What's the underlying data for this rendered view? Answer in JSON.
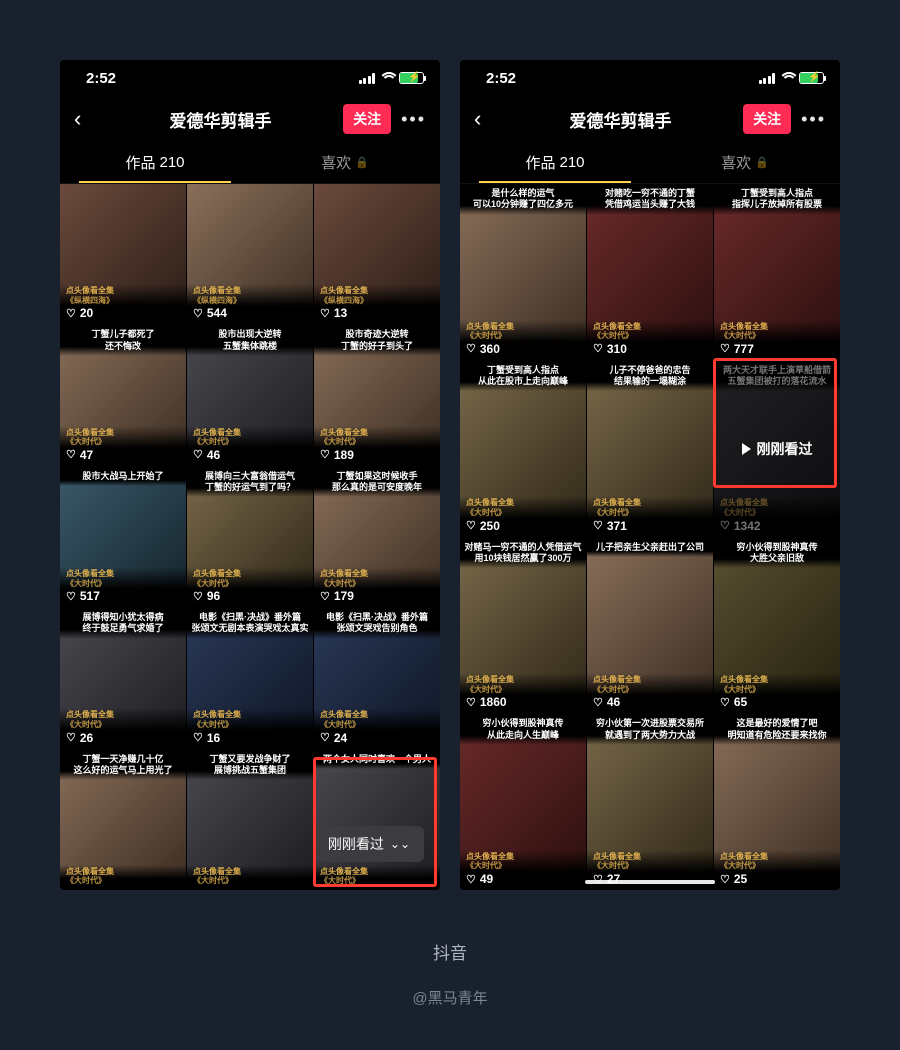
{
  "status_time": "2:52",
  "header": {
    "title": "爱德华剪辑手",
    "follow_label": "关注",
    "more_label": "•••"
  },
  "tabs": {
    "works_label": "作品",
    "works_count": "210",
    "likes_label": "喜欢"
  },
  "overlays": {
    "just_watched_pill": "刚刚看过",
    "just_watched_inline": "刚刚看过"
  },
  "footer": {
    "app_name": "抖音",
    "credit": "@黑马青年"
  },
  "subtitle_line1": "点头像看全集",
  "subtitle_show_a": "《纵横四海》",
  "subtitle_show_b": "《大时代》",
  "left": {
    "r1": [
      {
        "cap": "",
        "likes": "20",
        "bg": "bg-a"
      },
      {
        "cap": "",
        "likes": "544",
        "bg": "bg-b"
      },
      {
        "cap": "",
        "likes": "13",
        "bg": "bg-a"
      }
    ],
    "r2": [
      {
        "cap": "丁蟹儿子都死了\n还不悔改",
        "likes": "47",
        "bg": "bg-b"
      },
      {
        "cap": "股市出现大逆转\n五蟹集体跳楼",
        "likes": "46",
        "bg": "bg-c"
      },
      {
        "cap": "股市奇迹大逆转\n丁蟹的好子到头了",
        "likes": "189",
        "bg": "bg-b"
      }
    ],
    "r3": [
      {
        "cap": "股市大战马上开始了",
        "likes": "517",
        "bg": "bg-e"
      },
      {
        "cap": "展博向三大富翁借运气\n丁蟹的好运气到了吗？",
        "likes": "96",
        "bg": "bg-h"
      },
      {
        "cap": "丁蟹如果这时候收手\n那么真的是可安度晚年",
        "likes": "179",
        "bg": "bg-b"
      }
    ],
    "r4": [
      {
        "cap": "展博得知小犹太得病\n终于鼓足勇气求婚了",
        "likes": "26",
        "bg": "bg-c"
      },
      {
        "cap": "电影《扫黑·决战》番外篇\n张颂文无剧本表演哭戏太真实",
        "likes": "16",
        "bg": "bg-g"
      },
      {
        "cap": "电影《扫黑·决战》番外篇\n张颂文哭戏告别角色",
        "likes": "24",
        "bg": "bg-g"
      }
    ],
    "r5": [
      {
        "cap": "丁蟹一天净赚几十亿\n这么好的运气马上用光了",
        "likes": "",
        "bg": "bg-b"
      },
      {
        "cap": "丁蟹又要发战争财了\n展博挑战五蟹集团",
        "likes": "",
        "bg": "bg-c"
      },
      {
        "cap": "两个女人同时喜欢一个男人",
        "likes": "",
        "bg": "bg-c"
      }
    ]
  },
  "right": {
    "r1": [
      {
        "cap": "是什么样的运气\n可以10分钟赚了四亿多元",
        "likes": "360",
        "bg": "bg-b"
      },
      {
        "cap": "对赌吃一穷不通的丁蟹\n凭借鸡运当头赚了大钱",
        "likes": "310",
        "bg": "bg-d"
      },
      {
        "cap": "丁蟹受到高人指点\n指挥儿子放掉所有股票",
        "likes": "777",
        "bg": "bg-d"
      }
    ],
    "r2": [
      {
        "cap": "丁蟹受到高人指点\n从此在股市上走向巅峰",
        "likes": "250",
        "bg": "bg-h"
      },
      {
        "cap": "儿子不停爸爸的忠告\n结果输的一塌糊涂",
        "likes": "371",
        "bg": "bg-h"
      },
      {
        "cap": "两大天才联手上演草船借箭\n五蟹集团被打的落花流水",
        "likes": "1342",
        "bg": "bg-c",
        "watched": true
      }
    ],
    "r3": [
      {
        "cap": "对赌马一穷不通的人凭借运气\n用10块钱居然赢了300万",
        "likes": "1860",
        "bg": "bg-h"
      },
      {
        "cap": "儿子把亲生父亲赶出了公司",
        "likes": "46",
        "bg": "bg-b"
      },
      {
        "cap": "穷小伙得到股神真传\n大胜父亲旧敌",
        "likes": "65",
        "bg": "bg-f"
      }
    ],
    "r4": [
      {
        "cap": "穷小伙得到股神真传\n从此走向人生巅峰",
        "likes": "49",
        "bg": "bg-d"
      },
      {
        "cap": "穷小伙第一次进股票交易所\n就遇到了两大势力大战",
        "likes": "27",
        "bg": "bg-h"
      },
      {
        "cap": "这是最好的爱情了吧\n明知道有危险还要来找你",
        "likes": "25",
        "bg": "bg-b"
      }
    ]
  }
}
